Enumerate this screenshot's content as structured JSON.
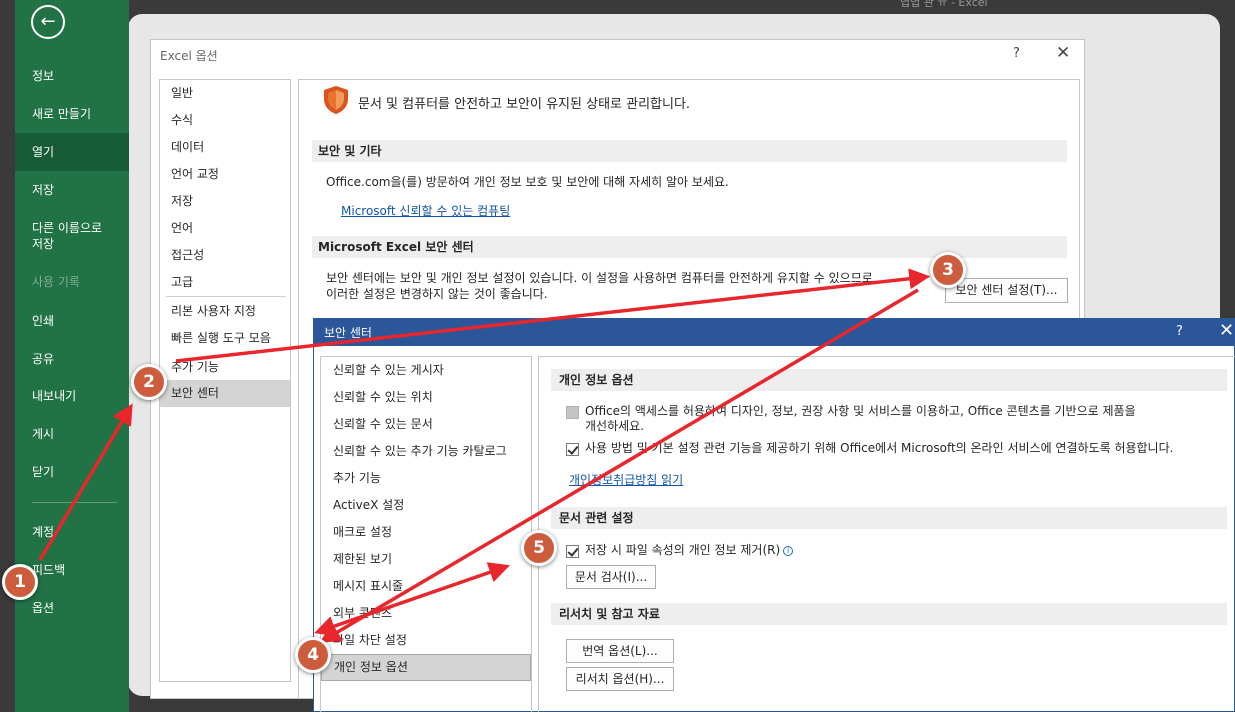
{
  "background": {
    "title": "엽엽 관 ㅠ - Excel"
  },
  "backstage": {
    "items": [
      {
        "label": "정보"
      },
      {
        "label": "새로 만들기"
      },
      {
        "label": "열기"
      },
      {
        "label": "저장"
      },
      {
        "label": "다른 이름으로 저장"
      },
      {
        "label": "사용 기록"
      },
      {
        "label": "인쇄"
      },
      {
        "label": "공유"
      },
      {
        "label": "내보내기"
      },
      {
        "label": "게시"
      },
      {
        "label": "닫기"
      },
      {
        "label": "계정"
      },
      {
        "label": "피드백"
      },
      {
        "label": "옵션"
      }
    ],
    "active_item": "열기"
  },
  "options_dialog": {
    "title": "Excel 옵션",
    "help": "?",
    "close": "✕",
    "nav": [
      {
        "label": "일반"
      },
      {
        "label": "수식"
      },
      {
        "label": "데이터"
      },
      {
        "label": "언어 교정"
      },
      {
        "label": "저장"
      },
      {
        "label": "언어"
      },
      {
        "label": "접근성"
      },
      {
        "label": "고급"
      },
      {
        "label": "리본 사용자 지정"
      },
      {
        "label": "빠른 실행 도구 모음"
      },
      {
        "label": "추가 기능"
      },
      {
        "label": "보안 센터"
      }
    ],
    "heading": "문서 및 컴퓨터를 안전하고 보안이 유지된 상태로 관리합니다.",
    "section_privacy": "보안 및 기타",
    "privacy_text": "Office.com을(를) 방문하여 개인 정보 보호 및 보안에 대해 자세히 알아 보세요.",
    "privacy_link": "Microsoft 신뢰할 수 있는 컴퓨팅",
    "section_trust": "Microsoft Excel 보안 센터",
    "trust_text_1": "보안 센터에는 보안 및 개인 정보 설정이 있습니다. 이 설정을 사용하면 컴퓨터를 안전하게 유지할 수 있으므로",
    "trust_text_2": "이러한 설정은 변경하지 않는 것이 좋습니다.",
    "trust_button": "보안 센터 설정(T)..."
  },
  "trust_center": {
    "title": "보안 센터",
    "help": "?",
    "close": "✕",
    "nav": [
      {
        "label": "신뢰할 수 있는 게시자"
      },
      {
        "label": "신뢰할 수 있는 위치"
      },
      {
        "label": "신뢰할 수 있는 문서"
      },
      {
        "label": "신뢰할 수 있는 추가 기능 카탈로그"
      },
      {
        "label": "추가 기능"
      },
      {
        "label": "ActiveX 설정"
      },
      {
        "label": "매크로 설정"
      },
      {
        "label": "제한된 보기"
      },
      {
        "label": "메시지 표시줄"
      },
      {
        "label": "외부 콘텐츠"
      },
      {
        "label": "파일 차단 설정"
      },
      {
        "label": "개인 정보 옵션"
      }
    ],
    "section_privacy": "개인 정보 옵션",
    "option1_line1": "Office의 액세스를 허용하여 디자인, 정보, 권장 사항 및 서비스를 이용하고, Office 콘텐츠를 기반으로 제품을",
    "option1_line2": "개선하세요.",
    "option1_checked": false,
    "option2": "사용 방법 및 기본 설정 관련 기능을 제공하기 위해 Office에서 Microsoft의 온라인 서비스에 연결하도록 허용합니다.",
    "option2_checked": true,
    "privacy_link": "개인정보취급방침 읽기",
    "section_doc": "문서 관련 설정",
    "doc_option": "저장 시 파일 속성의 개인 정보 제거(R)",
    "doc_option_checked": true,
    "info_glyph": "i",
    "doc_button": "문서 검사(I)...",
    "section_research": "리서치 및 참고 자료",
    "translate_button": "번역 옵션(L)...",
    "research_button": "리서치 옵션(H)..."
  },
  "annotations": {
    "color": "#e8262b",
    "badge_color": "#cd5c3c",
    "badges": [
      "1",
      "2",
      "3",
      "4",
      "5"
    ]
  }
}
